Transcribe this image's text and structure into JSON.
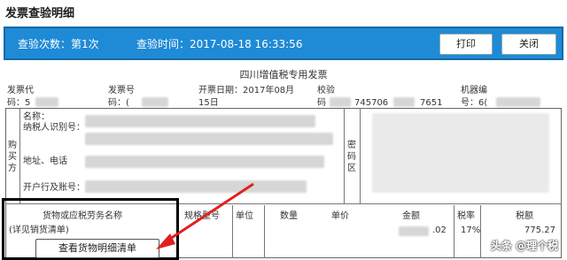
{
  "page": {
    "title": "发票查验明细"
  },
  "toolbar": {
    "check_count": "查验次数：第1次",
    "check_time": "查验时间：2017-08-18 16:33:56",
    "print_label": "打印",
    "close_label": "关闭"
  },
  "invoice": {
    "title": "四川增值税专用发票",
    "code_label_1": "发票代",
    "code_label_2": "码：5",
    "number_label": "发票号",
    "number_label_2": "码：(",
    "date_label": "开票日期：2017年08月",
    "date_label_2": "15日",
    "check_label": "校验",
    "check_label_2": "码",
    "check_value_1": "745706",
    "check_value_2": "7651",
    "machine_label": "机器编",
    "machine_label_2": "号：6(",
    "buyer_side": "购买方",
    "buyer_name_label": "名称：",
    "buyer_tax_label": "纳税人识别号：",
    "buyer_addr_label": "地址、电话",
    "buyer_bank_label": "开户行及账号：",
    "cipher_label": "密码区",
    "cols": {
      "goods": "货物或应税劳务名称",
      "spec": "规格型号",
      "unit": "单位",
      "qty": "数量",
      "price": "单价",
      "amount": "金额",
      "rate": "税率",
      "tax": "税额"
    },
    "goods_value": "(详见销货清单)",
    "amount_value": ".02",
    "rate_value": "17%",
    "tax_value": "775.27"
  },
  "detail_button": "查看货物明细清单",
  "watermark": "头条 @理个税",
  "colors": {
    "bar": "#1f8ad6",
    "arrow": "#e02020"
  }
}
